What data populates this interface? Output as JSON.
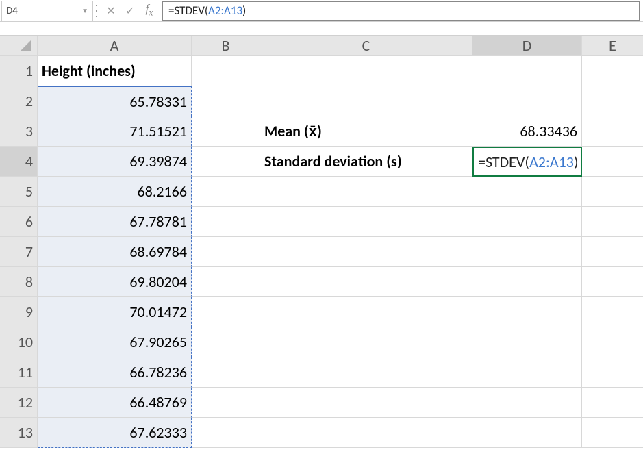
{
  "nameBox": {
    "value": "D4"
  },
  "formulaBar": {
    "formula_prefix": "=STDEV(",
    "formula_ref": "A2:A13",
    "formula_suffix": ")"
  },
  "columns": [
    "A",
    "B",
    "C",
    "D",
    "E"
  ],
  "rows": [
    "1",
    "2",
    "3",
    "4",
    "5",
    "6",
    "7",
    "8",
    "9",
    "10",
    "11",
    "12",
    "13"
  ],
  "cells": {
    "A1": "Height (inches)",
    "A2": "65.78331",
    "A3": "71.51521",
    "A4": "69.39874",
    "A5": "68.2166",
    "A6": "67.78781",
    "A7": "68.69784",
    "A8": "69.80204",
    "A9": "70.01472",
    "A10": "67.90265",
    "A11": "66.78236",
    "A12": "66.48769",
    "A13": "67.62333",
    "C3": "Mean (x̄)",
    "C4": "Standard deviation (s)",
    "D3": "68.33436",
    "D4_prefix": "=STDEV(",
    "D4_ref": "A2:A13",
    "D4_suffix": ")"
  },
  "activeCell": "D4",
  "selectedRange": "A2:A13"
}
